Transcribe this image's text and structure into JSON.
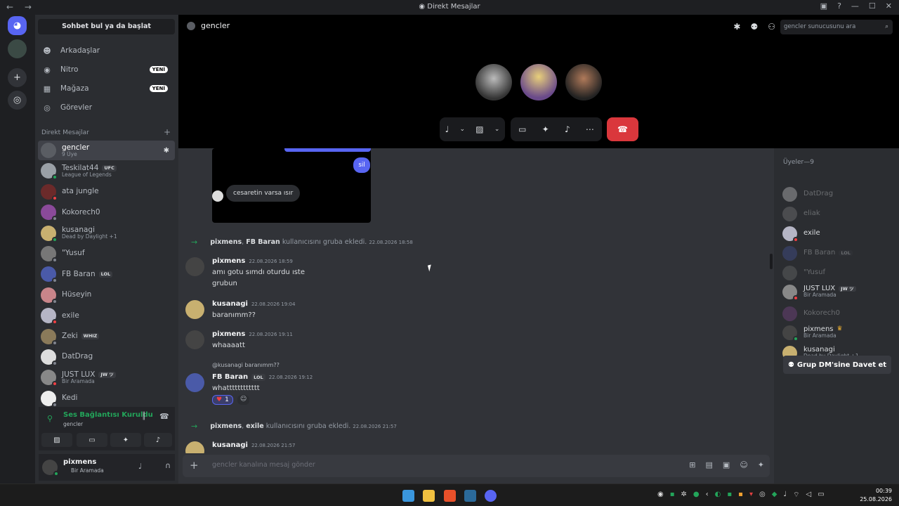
{
  "window": {
    "title": "Direkt Mesajlar",
    "nav": "← →",
    "controls": [
      "▣",
      "?",
      "—",
      "☐",
      "✕"
    ]
  },
  "dmcol": {
    "search_button": "Sohbet bul ya da başlat",
    "nav": [
      {
        "label": "Arkadaşlar",
        "icon": "friends-icon",
        "glyph": "☻"
      },
      {
        "label": "Nitro",
        "icon": "nitro-icon",
        "glyph": "◉",
        "badge": "YENİ"
      },
      {
        "label": "Mağaza",
        "icon": "shop-icon",
        "glyph": "▦",
        "badge": "YENİ"
      },
      {
        "label": "Görevler",
        "icon": "quests-icon",
        "glyph": "◎"
      }
    ],
    "dm_header": "Direkt Mesajlar",
    "dm_list": [
      {
        "name": "gencler",
        "sub": "9 Üye",
        "active": true,
        "color": "#5a5d63"
      },
      {
        "name": "Teskilat44",
        "tag": "UFC",
        "sub": "League of Legends",
        "color": "#9aa0a6",
        "status": "#23a55a"
      },
      {
        "name": "ata jungle",
        "color": "#6b2a2a",
        "status": "#f23f43"
      },
      {
        "name": "Kokorech0",
        "color": "#8a4a9a",
        "status": "#80848e"
      },
      {
        "name": "kusanagi",
        "sub": "Dead by Daylight +1",
        "color": "#c8b070",
        "status": "#23a55a"
      },
      {
        "name": "\"Yusuf",
        "color": "#777",
        "status": "#80848e"
      },
      {
        "name": "FB Baran",
        "tag": "LOL",
        "color": "#4a5aa8",
        "status": "#80848e"
      },
      {
        "name": "Hüseyin",
        "color": "#c9858a",
        "status": "#80848e"
      },
      {
        "name": "exile",
        "color": "#b5b5c5",
        "status": "#f23f43"
      },
      {
        "name": "Zeki",
        "tag": "WHIZ",
        "color": "#8a7a5a",
        "status": "#80848e"
      },
      {
        "name": "DatDrag",
        "color": "#ddd",
        "status": "#80848e"
      },
      {
        "name": "JUST LUX",
        "tag": "JW ツ",
        "sub": "Bir Aramada",
        "color": "#888",
        "status": "#f23f43"
      },
      {
        "name": "Kedi",
        "color": "#eee",
        "status": "#80848e"
      }
    ],
    "voice": {
      "status": "Ses Bağlantısı Kuruldu",
      "channel": "gencler"
    },
    "user": {
      "name": "pixmens",
      "status": "Bir Aramada"
    }
  },
  "main": {
    "channel": "gencler",
    "search_placeholder": "gencler sunucusunu ara",
    "embed": {
      "bubble_me": "sil",
      "bubble_other": "cesaretin varsa ısır"
    },
    "system1": {
      "a": "pixmens",
      "b": "FB Baran",
      "text": "kullanıcısını gruba ekledi.",
      "time": "22.08.2026 18:58"
    },
    "messages": [
      {
        "user": "pixmens",
        "time": "22.08.2026 18:59",
        "lines": [
          "amı gotu sımdı oturdu ıste",
          "grubun"
        ],
        "color": "#444"
      },
      {
        "user": "kusanagi",
        "time": "22.08.2026 19:04",
        "lines": [
          "baranımm??"
        ],
        "color": "#c8b070"
      },
      {
        "user": "pixmens",
        "time": "22.08.2026 19:11",
        "lines": [
          "whaaaatt"
        ],
        "color": "#444"
      },
      {
        "user": "FB Baran",
        "tag": "LOL",
        "time": "22.08.2026 19:12",
        "reply": "@kusanagi baranımm??",
        "lines": [
          "whatttttttttttt"
        ],
        "reaction": "1",
        "color": "#4a5aa8"
      },
      {
        "user": "kusanagi",
        "time": "22.08.2026 21:57",
        "lines": [],
        "color": "#c8b070"
      }
    ],
    "system2": {
      "a": "pixmens",
      "b": "exile",
      "text": "kullanıcısını gruba ekledi.",
      "time": "22.08.2026 21:57"
    },
    "composer_placeholder": "gencler kanalına mesaj gönder"
  },
  "members": {
    "header": "Üyeler—9",
    "list": [
      {
        "name": "DatDrag",
        "off": true,
        "color": "#ddd"
      },
      {
        "name": "eliak",
        "off": true,
        "color": "#888"
      },
      {
        "name": "exile",
        "off": false,
        "color": "#b5b5c5",
        "status": "#f23f43"
      },
      {
        "name": "FB Baran",
        "tag": "LOL",
        "off": true,
        "color": "#4a5aa8"
      },
      {
        "name": "\"Yusuf",
        "off": true,
        "color": "#777"
      },
      {
        "name": "JUST LUX",
        "tag": "JW ツ",
        "sub": "Bir Aramada",
        "off": false,
        "color": "#888",
        "status": "#f23f43"
      },
      {
        "name": "Kokorech0",
        "off": true,
        "color": "#8a4a9a"
      },
      {
        "name": "pixmens",
        "crown": "♛",
        "sub": "Bir Aramada",
        "off": false,
        "color": "#444",
        "status": "#23a55a"
      },
      {
        "name": "kusanagi",
        "sub": "Dead by Daylight +1",
        "off": false,
        "color": "#c8b070",
        "status": "#23a55a"
      }
    ],
    "invite_button": "Grup DM'sine Davet et"
  },
  "taskbar": {
    "time": "00:39",
    "date": "25.08.2026"
  }
}
